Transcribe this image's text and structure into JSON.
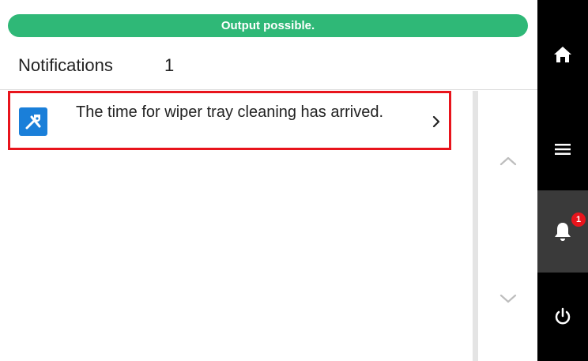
{
  "status": {
    "text": "Output possible.",
    "color": "#2fb877"
  },
  "header": {
    "title": "Notifications",
    "count": "1"
  },
  "notifications": [
    {
      "icon": "tools-icon",
      "text": "The time for wiper tray cleaning has arrived.",
      "highlight_color": "#e8141c"
    }
  ],
  "sidebar": {
    "items": [
      {
        "icon": "home-icon"
      },
      {
        "icon": "menu-icon"
      },
      {
        "icon": "bell-icon",
        "badge": "1",
        "active": true
      },
      {
        "icon": "power-icon"
      }
    ]
  }
}
